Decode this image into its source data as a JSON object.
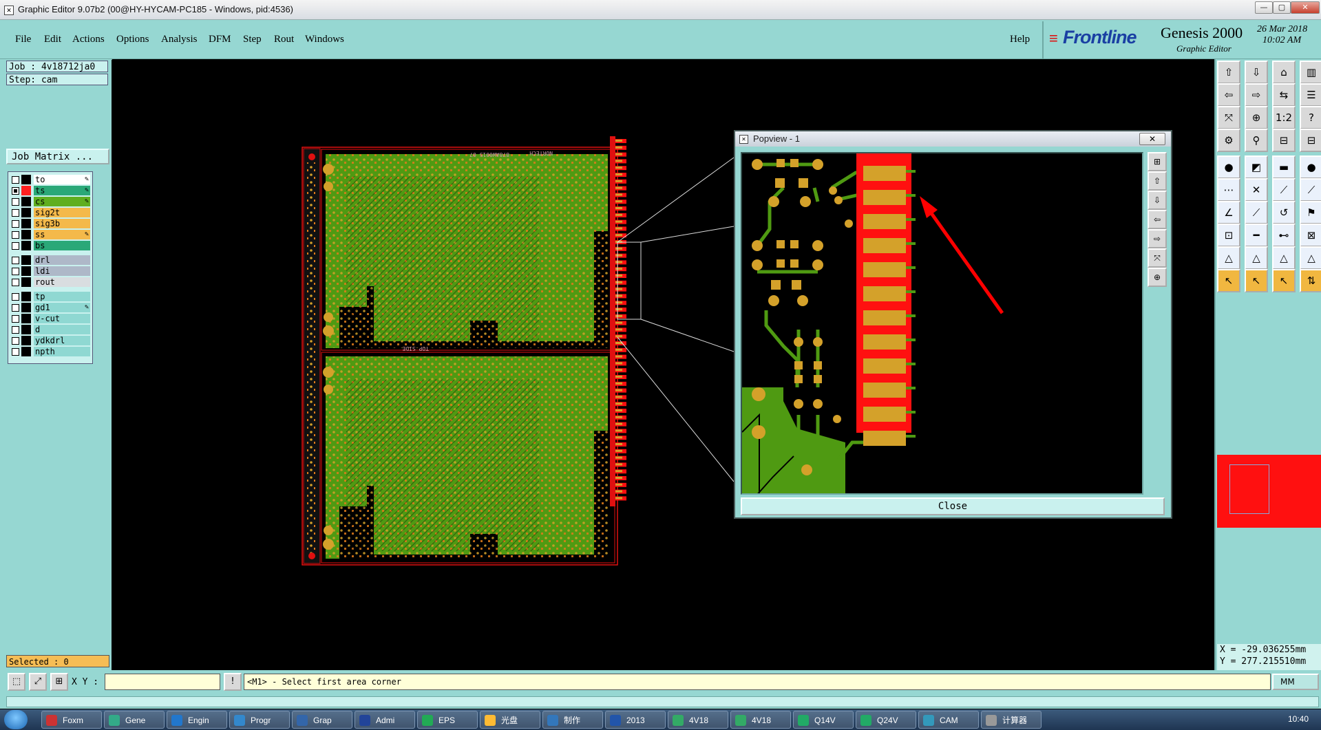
{
  "window": {
    "title": "Graphic Editor 9.07b2 (00@HY-HYCAM-PC185 - Windows, pid:4536)",
    "min_label": "—",
    "max_label": "▢",
    "close_label": "✕"
  },
  "menu": {
    "items": [
      "File",
      "Edit",
      "Actions",
      "Options",
      "Analysis",
      "DFM",
      "Step",
      "Rout",
      "Windows"
    ],
    "help": "Help"
  },
  "brand": {
    "logo": "Frontline",
    "product": "Genesis 2000",
    "subtitle": "Graphic Editor",
    "date": "26 Mar 2018",
    "time": "10:02 AM"
  },
  "job": {
    "job_label": "Job : 4v18712ja0",
    "step_label": "Step: cam",
    "matrix_button": "Job Matrix ..."
  },
  "layers": [
    {
      "name": "to",
      "checked": false,
      "swatch": "#000000",
      "bg": "#ffffff",
      "editable": true
    },
    {
      "name": "ts",
      "checked": true,
      "swatch": "#ff2020",
      "bg": "#2aa878",
      "editable": true
    },
    {
      "name": "cs",
      "checked": false,
      "swatch": "#000000",
      "bg": "#5fae1f",
      "editable": true
    },
    {
      "name": "sig2t",
      "checked": false,
      "swatch": "#000000",
      "bg": "#f4b94a",
      "editable": false
    },
    {
      "name": "sig3b",
      "checked": false,
      "swatch": "#000000",
      "bg": "#f4b94a",
      "editable": false
    },
    {
      "name": "ss",
      "checked": false,
      "swatch": "#000000",
      "bg": "#f4b94a",
      "editable": true
    },
    {
      "name": "bs",
      "checked": false,
      "swatch": "#000000",
      "bg": "#2aa878",
      "editable": false
    },
    {
      "name": "drl",
      "checked": false,
      "swatch": "#000000",
      "bg": "#aeb8c8",
      "editable": false
    },
    {
      "name": "ldi",
      "checked": false,
      "swatch": "#000000",
      "bg": "#aeb8c8",
      "editable": false
    },
    {
      "name": "rout",
      "checked": false,
      "swatch": "#000000",
      "bg": "#d9dde0",
      "editable": false
    },
    {
      "name": "tp",
      "checked": false,
      "swatch": "#000000",
      "bg": "#8fd8d2",
      "editable": false
    },
    {
      "name": "gd1",
      "checked": false,
      "swatch": "#000000",
      "bg": "#8fd8d2",
      "editable": true
    },
    {
      "name": "v-cut",
      "checked": false,
      "swatch": "#000000",
      "bg": "#8fd8d2",
      "editable": false
    },
    {
      "name": "d",
      "checked": false,
      "swatch": "#000000",
      "bg": "#8fd8d2",
      "editable": false
    },
    {
      "name": "ydkdrl",
      "checked": false,
      "swatch": "#000000",
      "bg": "#8fd8d2",
      "editable": false
    },
    {
      "name": "npth",
      "checked": false,
      "swatch": "#000000",
      "bg": "#8fd8d2",
      "editable": false
    }
  ],
  "selected": "Selected : 0",
  "board": {
    "silk_top": "TOP SIDE",
    "silk_part": "878AW0015 07",
    "silk_brand": "NORTECH"
  },
  "popview": {
    "title": "Popview - 1",
    "close_x": "✕",
    "close_button": "Close"
  },
  "coords": {
    "x": "X = -29.036255mm",
    "y": "Y = 277.215510mm"
  },
  "bottom": {
    "xy_label": "X Y :",
    "xy_value": "",
    "prompt": "<M1> - Select first area corner",
    "units": "MM"
  },
  "taskbar": {
    "items": [
      "Foxm",
      "Gene",
      "Engin",
      "Progr",
      "Grap",
      "Admi",
      "EPS",
      "光盘",
      "制作",
      "2013",
      "4V18",
      "4V18",
      "Q14V",
      "Q24V",
      "CAM",
      "计算器"
    ],
    "clock": "10:40"
  },
  "colors": {
    "panel": "#96d7d2",
    "copper": "#4f9a12",
    "pad": "#d4a12a",
    "fingers": "#ff1010",
    "arrow": "#ff0000"
  }
}
